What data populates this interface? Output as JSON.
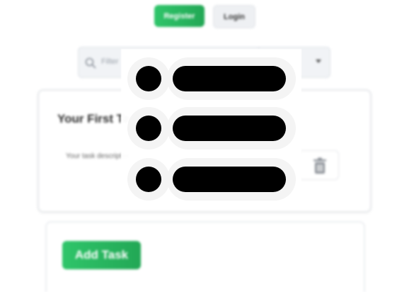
{
  "header": {
    "register_label": "Register",
    "login_label": "Login"
  },
  "filter": {
    "search_icon": "search-icon",
    "placeholder": "Filter",
    "select_chevron_icon": "chevron-down-icon"
  },
  "task": {
    "title": "Your First Task",
    "description": "Your task description",
    "delete_icon": "trash-icon"
  },
  "add_task": {
    "label": "Add Task"
  },
  "overlay": {
    "icon": "list-icon",
    "rows": 3
  },
  "colors": {
    "accent_green": "#2fc56a",
    "accent_green_dark": "#22a755",
    "overlay_mark": "#000000"
  }
}
